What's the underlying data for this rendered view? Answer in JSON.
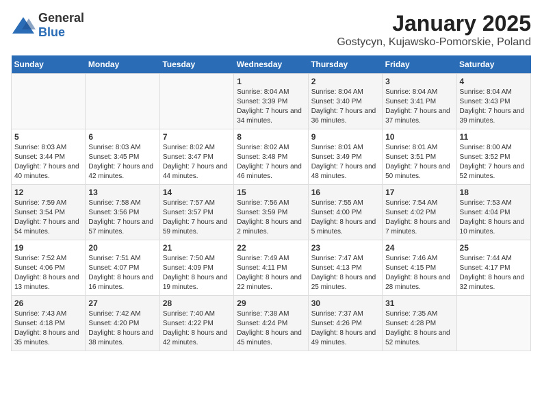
{
  "header": {
    "logo_general": "General",
    "logo_blue": "Blue",
    "title": "January 2025",
    "subtitle": "Gostycyn, Kujawsko-Pomorskie, Poland"
  },
  "calendar": {
    "days_of_week": [
      "Sunday",
      "Monday",
      "Tuesday",
      "Wednesday",
      "Thursday",
      "Friday",
      "Saturday"
    ],
    "weeks": [
      [
        {
          "day": "",
          "info": ""
        },
        {
          "day": "",
          "info": ""
        },
        {
          "day": "",
          "info": ""
        },
        {
          "day": "1",
          "info": "Sunrise: 8:04 AM\nSunset: 3:39 PM\nDaylight: 7 hours and 34 minutes."
        },
        {
          "day": "2",
          "info": "Sunrise: 8:04 AM\nSunset: 3:40 PM\nDaylight: 7 hours and 36 minutes."
        },
        {
          "day": "3",
          "info": "Sunrise: 8:04 AM\nSunset: 3:41 PM\nDaylight: 7 hours and 37 minutes."
        },
        {
          "day": "4",
          "info": "Sunrise: 8:04 AM\nSunset: 3:43 PM\nDaylight: 7 hours and 39 minutes."
        }
      ],
      [
        {
          "day": "5",
          "info": "Sunrise: 8:03 AM\nSunset: 3:44 PM\nDaylight: 7 hours and 40 minutes."
        },
        {
          "day": "6",
          "info": "Sunrise: 8:03 AM\nSunset: 3:45 PM\nDaylight: 7 hours and 42 minutes."
        },
        {
          "day": "7",
          "info": "Sunrise: 8:02 AM\nSunset: 3:47 PM\nDaylight: 7 hours and 44 minutes."
        },
        {
          "day": "8",
          "info": "Sunrise: 8:02 AM\nSunset: 3:48 PM\nDaylight: 7 hours and 46 minutes."
        },
        {
          "day": "9",
          "info": "Sunrise: 8:01 AM\nSunset: 3:49 PM\nDaylight: 7 hours and 48 minutes."
        },
        {
          "day": "10",
          "info": "Sunrise: 8:01 AM\nSunset: 3:51 PM\nDaylight: 7 hours and 50 minutes."
        },
        {
          "day": "11",
          "info": "Sunrise: 8:00 AM\nSunset: 3:52 PM\nDaylight: 7 hours and 52 minutes."
        }
      ],
      [
        {
          "day": "12",
          "info": "Sunrise: 7:59 AM\nSunset: 3:54 PM\nDaylight: 7 hours and 54 minutes."
        },
        {
          "day": "13",
          "info": "Sunrise: 7:58 AM\nSunset: 3:56 PM\nDaylight: 7 hours and 57 minutes."
        },
        {
          "day": "14",
          "info": "Sunrise: 7:57 AM\nSunset: 3:57 PM\nDaylight: 7 hours and 59 minutes."
        },
        {
          "day": "15",
          "info": "Sunrise: 7:56 AM\nSunset: 3:59 PM\nDaylight: 8 hours and 2 minutes."
        },
        {
          "day": "16",
          "info": "Sunrise: 7:55 AM\nSunset: 4:00 PM\nDaylight: 8 hours and 5 minutes."
        },
        {
          "day": "17",
          "info": "Sunrise: 7:54 AM\nSunset: 4:02 PM\nDaylight: 8 hours and 7 minutes."
        },
        {
          "day": "18",
          "info": "Sunrise: 7:53 AM\nSunset: 4:04 PM\nDaylight: 8 hours and 10 minutes."
        }
      ],
      [
        {
          "day": "19",
          "info": "Sunrise: 7:52 AM\nSunset: 4:06 PM\nDaylight: 8 hours and 13 minutes."
        },
        {
          "day": "20",
          "info": "Sunrise: 7:51 AM\nSunset: 4:07 PM\nDaylight: 8 hours and 16 minutes."
        },
        {
          "day": "21",
          "info": "Sunrise: 7:50 AM\nSunset: 4:09 PM\nDaylight: 8 hours and 19 minutes."
        },
        {
          "day": "22",
          "info": "Sunrise: 7:49 AM\nSunset: 4:11 PM\nDaylight: 8 hours and 22 minutes."
        },
        {
          "day": "23",
          "info": "Sunrise: 7:47 AM\nSunset: 4:13 PM\nDaylight: 8 hours and 25 minutes."
        },
        {
          "day": "24",
          "info": "Sunrise: 7:46 AM\nSunset: 4:15 PM\nDaylight: 8 hours and 28 minutes."
        },
        {
          "day": "25",
          "info": "Sunrise: 7:44 AM\nSunset: 4:17 PM\nDaylight: 8 hours and 32 minutes."
        }
      ],
      [
        {
          "day": "26",
          "info": "Sunrise: 7:43 AM\nSunset: 4:18 PM\nDaylight: 8 hours and 35 minutes."
        },
        {
          "day": "27",
          "info": "Sunrise: 7:42 AM\nSunset: 4:20 PM\nDaylight: 8 hours and 38 minutes."
        },
        {
          "day": "28",
          "info": "Sunrise: 7:40 AM\nSunset: 4:22 PM\nDaylight: 8 hours and 42 minutes."
        },
        {
          "day": "29",
          "info": "Sunrise: 7:38 AM\nSunset: 4:24 PM\nDaylight: 8 hours and 45 minutes."
        },
        {
          "day": "30",
          "info": "Sunrise: 7:37 AM\nSunset: 4:26 PM\nDaylight: 8 hours and 49 minutes."
        },
        {
          "day": "31",
          "info": "Sunrise: 7:35 AM\nSunset: 4:28 PM\nDaylight: 8 hours and 52 minutes."
        },
        {
          "day": "",
          "info": ""
        }
      ]
    ]
  }
}
